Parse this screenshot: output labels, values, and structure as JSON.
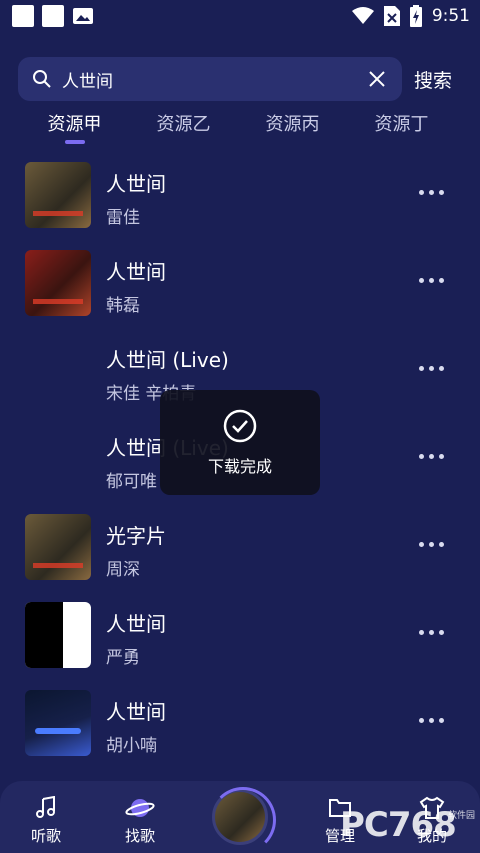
{
  "status_bar": {
    "time": "9:51"
  },
  "search": {
    "value": "人世间",
    "button_label": "搜索"
  },
  "tabs": [
    {
      "label": "资源甲",
      "active": true
    },
    {
      "label": "资源乙",
      "active": false
    },
    {
      "label": "资源丙",
      "active": false
    },
    {
      "label": "资源丁",
      "active": false
    }
  ],
  "songs": [
    {
      "title": "人世间",
      "artist": "雷佳",
      "cover": "drama-cover-a"
    },
    {
      "title": "人世间",
      "artist": "韩磊",
      "cover": "drama-cover-b"
    },
    {
      "title": "人世间 (Live)",
      "artist": "宋佳 辛柏青",
      "cover": ""
    },
    {
      "title": "人世间 (Live)",
      "artist": "郁可唯",
      "cover": ""
    },
    {
      "title": "光字片",
      "artist": "周深",
      "cover": "drama-cover-a"
    },
    {
      "title": "人世间",
      "artist": "严勇",
      "cover": "bw-cover"
    },
    {
      "title": "人世间",
      "artist": "胡小喃",
      "cover": "blue-cover"
    }
  ],
  "toast": {
    "text": "下载完成"
  },
  "bottom_nav": [
    {
      "label": "听歌",
      "icon": "music-note-icon"
    },
    {
      "label": "找歌",
      "icon": "planet-icon"
    },
    {
      "label": "管理",
      "icon": "folder-icon"
    },
    {
      "label": "我的",
      "icon": "shirt-icon"
    }
  ],
  "watermark": {
    "text": "PC768",
    "sub": "软件园"
  },
  "colors": {
    "background": "#1a1f55",
    "accent": "#7c6cf0"
  }
}
